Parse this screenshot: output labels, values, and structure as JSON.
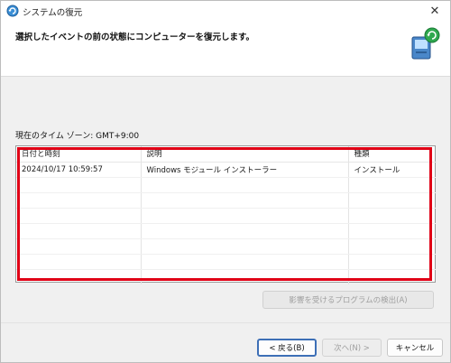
{
  "window": {
    "title": "システムの復元",
    "close_glyph": "✕"
  },
  "header": {
    "text": "選択したイベントの前の状態にコンピューターを復元します。"
  },
  "timezone_label": "現在のタイム ゾーン: GMT+9:00",
  "table": {
    "columns": [
      "日付と時刻",
      "説明",
      "種類"
    ],
    "rows": [
      [
        "2024/10/17 10:59:57",
        "Windows モジュール インストーラー",
        "インストール"
      ]
    ]
  },
  "buttons": {
    "detect": "影響を受けるプログラムの検出(A)",
    "back": "< 戻る(B)",
    "next": "次へ(N) >",
    "cancel": "キャンセル"
  },
  "colors": {
    "highlight": "#e00016",
    "focus": "#3d6fb6"
  }
}
